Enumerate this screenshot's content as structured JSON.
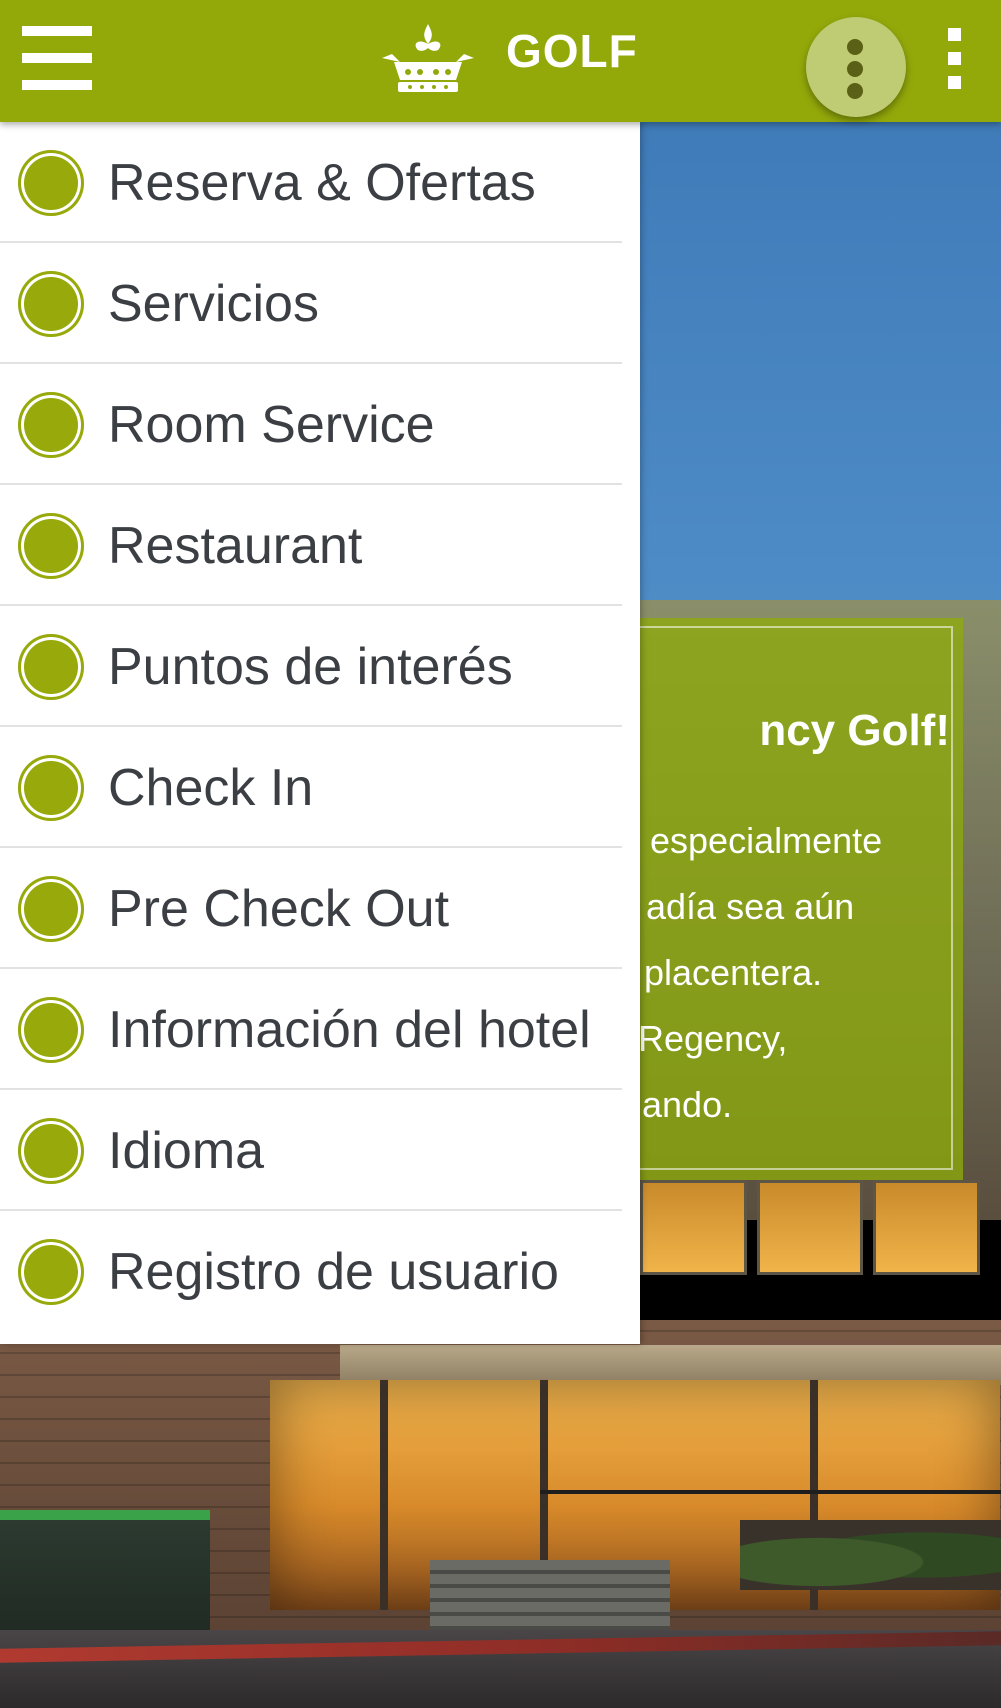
{
  "app_bar": {
    "title": "GOLF",
    "menu_icon": "hamburger-menu-icon",
    "logo_icon": "crown-logo-icon",
    "fab_icon": "more-vertical-icon",
    "overflow_icon": "overflow-menu-icon",
    "color": "#93a90a"
  },
  "drawer": {
    "bullet_color": "#97a90b",
    "text_color": "#3b3f44",
    "items": [
      {
        "label": "Reserva & Ofertas"
      },
      {
        "label": "Servicios"
      },
      {
        "label": "Room Service"
      },
      {
        "label": "Restaurant"
      },
      {
        "label": "Puntos de interés"
      },
      {
        "label": "Check In"
      },
      {
        "label": "Pre Check Out"
      },
      {
        "label": "Información del hotel"
      },
      {
        "label": "Idioma"
      },
      {
        "label": "Registro de usuario"
      }
    ]
  },
  "welcome_card": {
    "title": "ncy Golf!",
    "lines": [
      "especialmente",
      "adía sea aún",
      "placentera.",
      "Regency,",
      "ando."
    ],
    "color": "#8daa0a"
  }
}
